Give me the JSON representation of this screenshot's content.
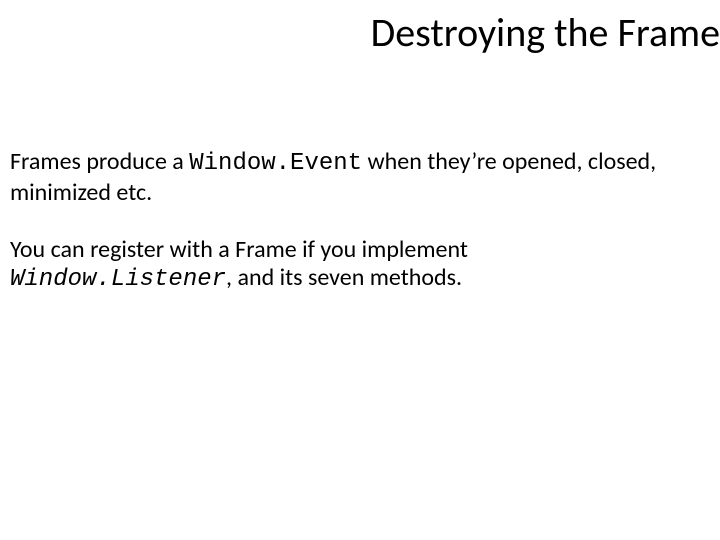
{
  "title": "Destroying the Frame",
  "p1a": "Frames produce a ",
  "p1code": "Window.Event",
  "p1b": " when they’re opened, closed, minimized etc.",
  "p2a": "You can register with a Frame if you implement ",
  "p2code": "Window.Listener",
  "p2b": ", and its seven methods."
}
